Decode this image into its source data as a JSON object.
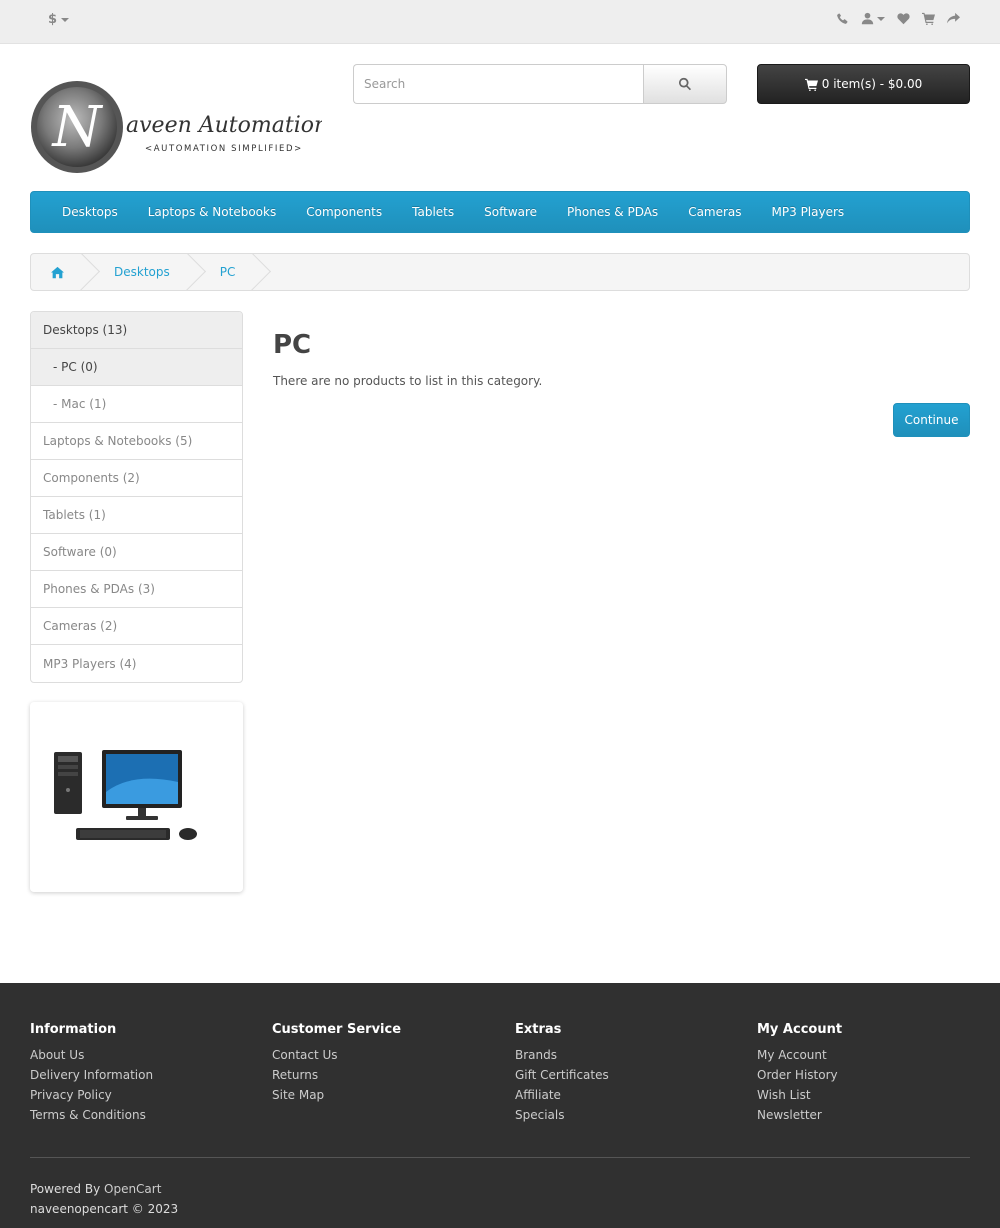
{
  "topbar": {
    "currency_label": "$",
    "icons": [
      "phone-icon",
      "user-icon",
      "heart-icon",
      "shopping-cart-icon",
      "share-icon"
    ]
  },
  "header": {
    "logo_text": "Naveen Automation Labs",
    "logo_tagline": "<AUTOMATION SIMPLIFIED>",
    "search_placeholder": "Search",
    "cart_label": "0 item(s) - $0.00"
  },
  "menu": {
    "items": [
      "Desktops",
      "Laptops & Notebooks",
      "Components",
      "Tablets",
      "Software",
      "Phones & PDAs",
      "Cameras",
      "MP3 Players"
    ]
  },
  "breadcrumb": {
    "items": [
      "Desktops",
      "PC"
    ]
  },
  "sidebar": {
    "categories": [
      {
        "label": "Desktops (13)"
      },
      {
        "label": "- PC (0)"
      },
      {
        "label": "- Mac (1)"
      },
      {
        "label": "Laptops & Notebooks (5)"
      },
      {
        "label": "Components (2)"
      },
      {
        "label": "Tablets (1)"
      },
      {
        "label": "Software (0)"
      },
      {
        "label": "Phones & PDAs (3)"
      },
      {
        "label": "Cameras (2)"
      },
      {
        "label": "MP3 Players (4)"
      }
    ]
  },
  "content": {
    "title": "PC",
    "empty_message": "There are no products to list in this category.",
    "continue_label": "Continue"
  },
  "footer": {
    "information": {
      "heading": "Information",
      "links": [
        "About Us",
        "Delivery Information",
        "Privacy Policy",
        "Terms & Conditions"
      ]
    },
    "customer_service": {
      "heading": "Customer Service",
      "links": [
        "Contact Us",
        "Returns",
        "Site Map"
      ]
    },
    "extras": {
      "heading": "Extras",
      "links": [
        "Brands",
        "Gift Certificates",
        "Affiliate",
        "Specials"
      ]
    },
    "my_account": {
      "heading": "My Account",
      "links": [
        "My Account",
        "Order History",
        "Wish List",
        "Newsletter"
      ]
    },
    "powered_prefix": "Powered By",
    "powered_link": "OpenCart",
    "copyright": "naveenopencart © 2023"
  },
  "colors": {
    "accent": "#23a1d1",
    "footer_bg": "#303030",
    "topbar_bg": "#eeeeee"
  }
}
